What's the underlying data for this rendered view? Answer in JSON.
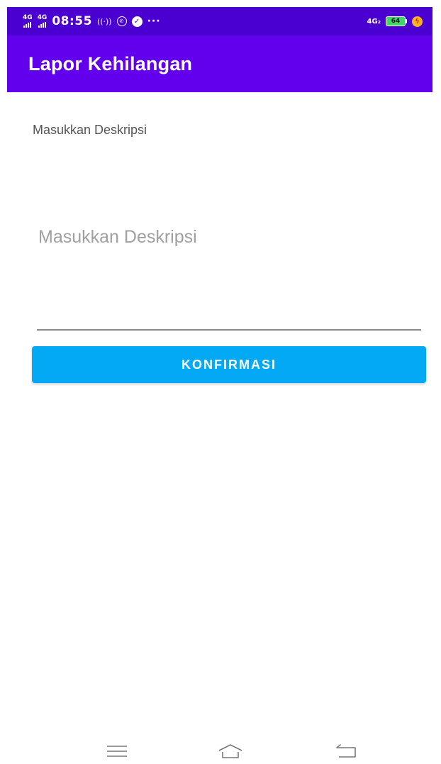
{
  "status_bar": {
    "network_1": "4G",
    "network_2": "4G",
    "time": "08:55",
    "more": "···",
    "network_right": "4G₂",
    "battery_level": "64"
  },
  "app_bar": {
    "title": "Lapor Kehilangan"
  },
  "form": {
    "label": "Masukkan Deskripsi",
    "input_placeholder": "Masukkan Deskripsi",
    "input_value": "",
    "confirm_label": "KONFIRMASI"
  },
  "colors": {
    "status_bar": "#4a00d1",
    "app_bar": "#6200ee",
    "button": "#03a9f4",
    "battery": "#43d36b"
  },
  "icons": {
    "status": [
      "signal-icon",
      "signal-icon",
      "hotspot-icon",
      "whatsapp-icon",
      "check-icon",
      "more-icon",
      "battery-icon",
      "charging-icon"
    ],
    "navigation": [
      "menu-icon",
      "home-icon",
      "back-icon"
    ]
  }
}
